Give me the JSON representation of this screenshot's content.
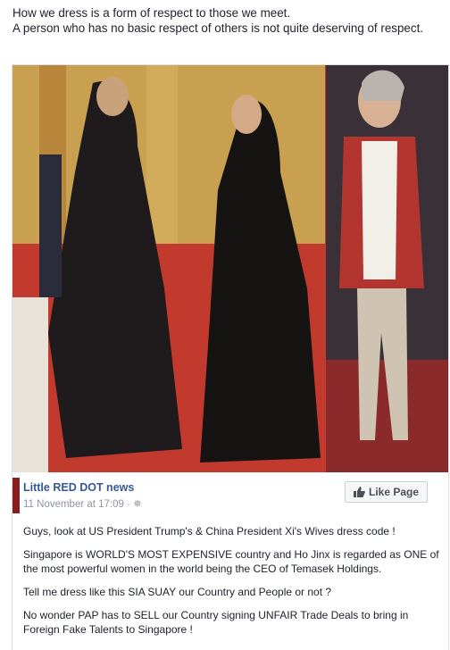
{
  "caption": {
    "line1": "How we dress is a form of respect to those we meet.",
    "line2": "A person who has no basic respect of others is not quite deserving of respect."
  },
  "post": {
    "page_name": "Little RED DOT news",
    "timestamp": "11 November at 17:09 · ",
    "audience_icon": "gear-icon",
    "like_label": "Like Page",
    "paragraphs": [
      "Guys, look at US President Trump's & China President Xi's Wives dress code !",
      "Singapore is WORLD'S MOST EXPENSIVE country and Ho Jinx is regarded as ONE of the most powerful women in the world being the CEO of Temasek Holdings.",
      "Tell me dress like this SIA SUAY our Country and People or not ?",
      "No wonder PAP has to SELL our Country signing UNFAIR Trade Deals to bring in Foreign Fake Talents to Singapore !"
    ]
  },
  "colors": {
    "link": "#365899",
    "meta": "#90949c",
    "text": "#1d2129"
  }
}
